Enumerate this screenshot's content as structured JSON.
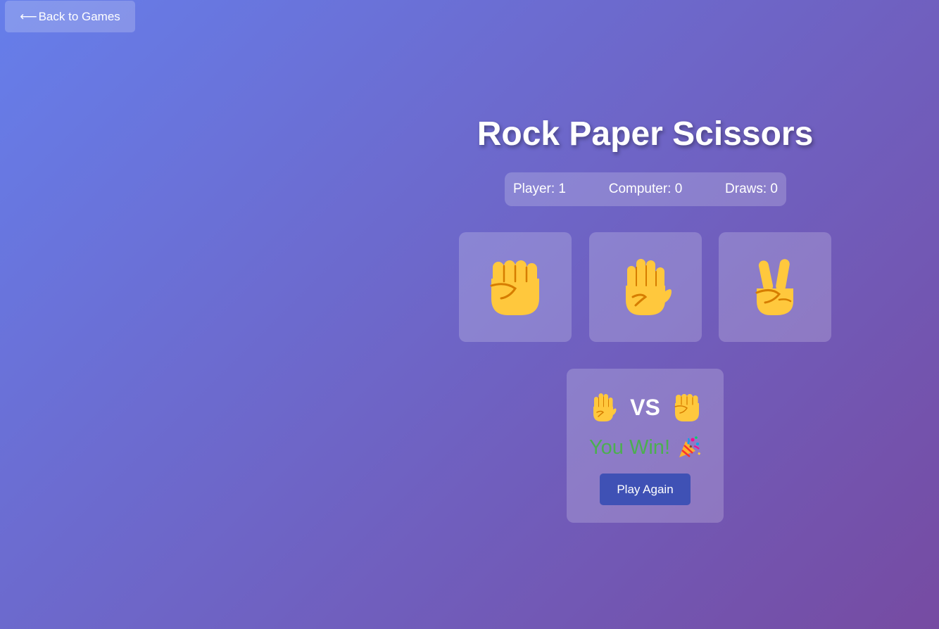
{
  "nav": {
    "back_arrow": "⟵",
    "back_label": "Back to Games"
  },
  "game": {
    "title": "Rock Paper Scissors",
    "scoreboard": {
      "player": "Player: 1",
      "computer": "Computer: 0",
      "draws": "Draws: 0"
    },
    "choices": [
      {
        "name": "rock",
        "icon": "raised-fist-icon"
      },
      {
        "name": "paper",
        "icon": "raised-hand-icon"
      },
      {
        "name": "scissors",
        "icon": "victory-hand-icon"
      }
    ],
    "result": {
      "player_choice_icon": "raised-hand-icon",
      "vs_label": "VS",
      "computer_choice_icon": "raised-fist-icon",
      "message": "You Win!",
      "message_icon": "party-popper-icon",
      "message_color": "#4caf50",
      "play_again_label": "Play Again"
    }
  },
  "colors": {
    "background_start": "#667eea",
    "background_end": "#764ba2",
    "button_primary": "#3f51b5",
    "emoji_yellow": "#ffc83d",
    "emoji_shade": "#d67d00"
  }
}
